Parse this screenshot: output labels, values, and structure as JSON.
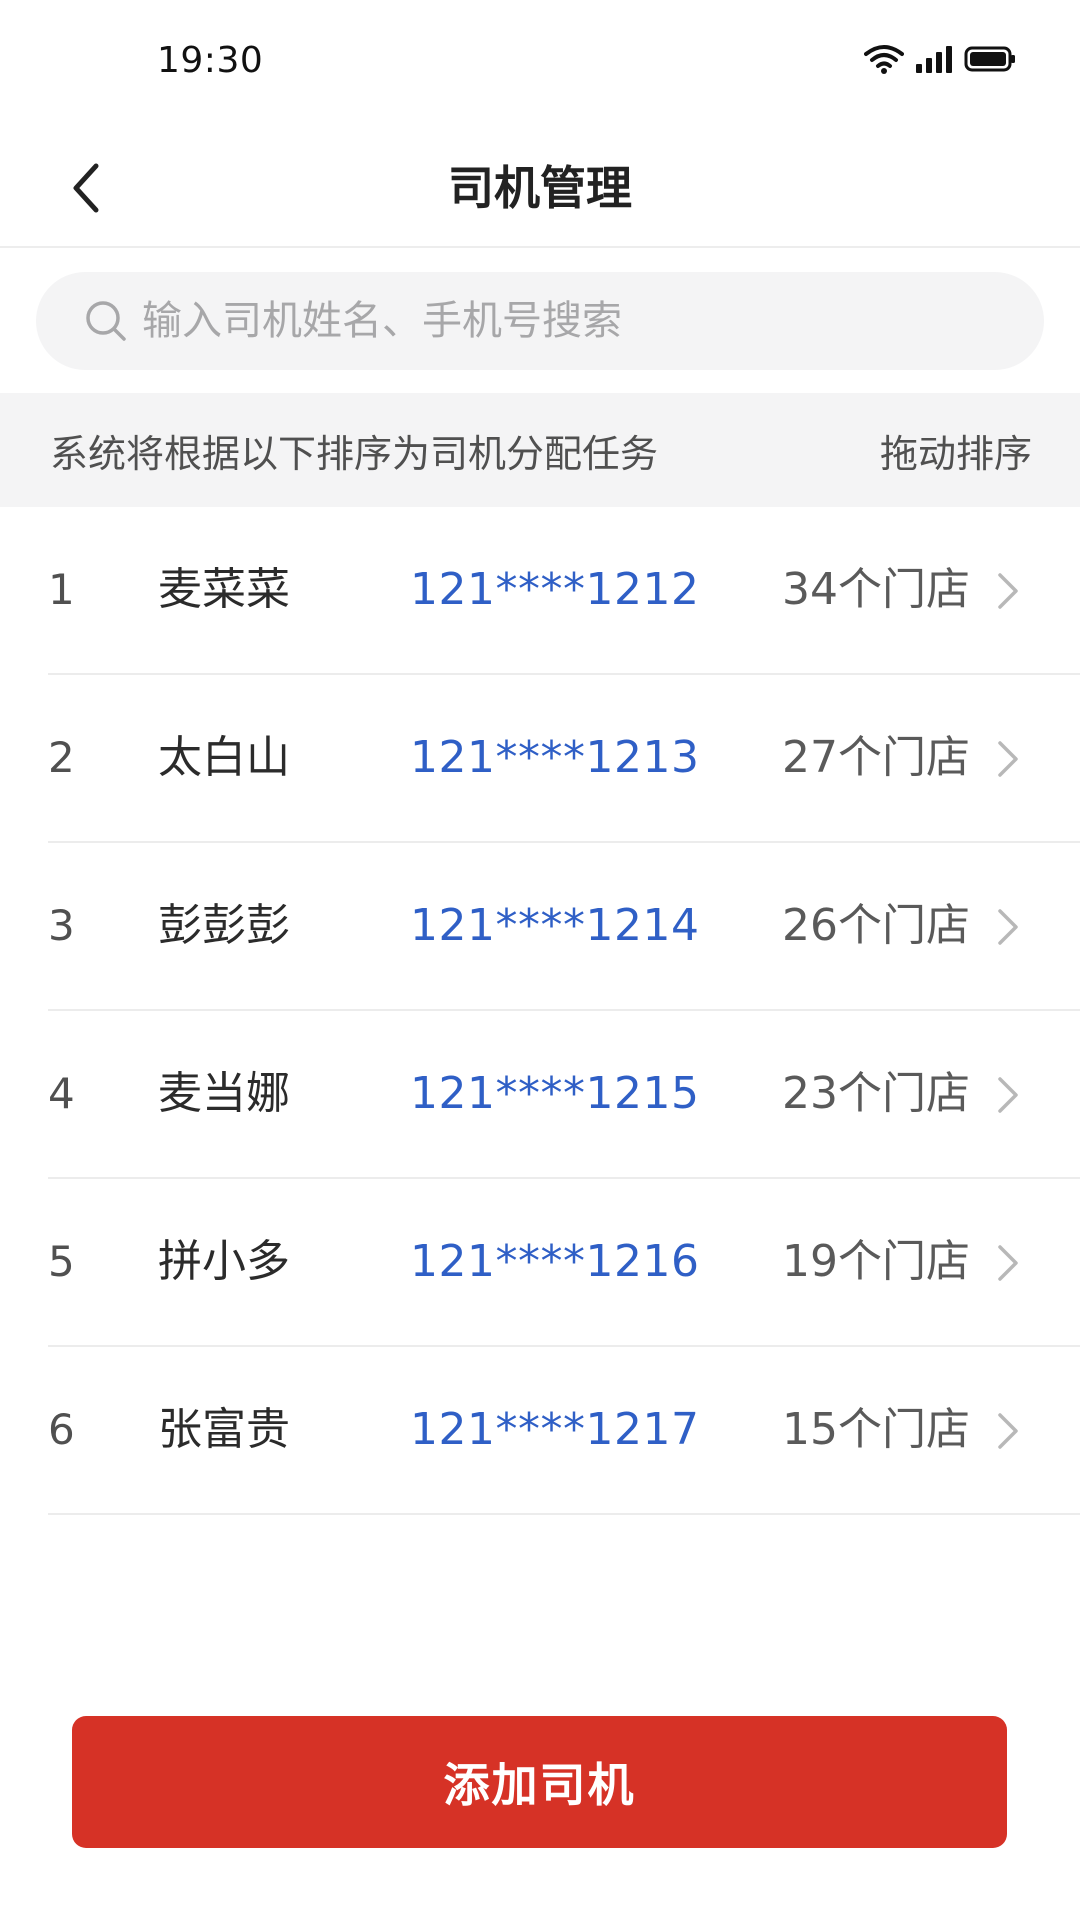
{
  "status_bar": {
    "time": "19:30"
  },
  "nav": {
    "title": "司机管理"
  },
  "search": {
    "placeholder": "输入司机姓名、手机号搜索"
  },
  "hint": {
    "text": "系统将根据以下排序为司机分配任务",
    "drag_sort_label": "拖动排序"
  },
  "drivers": [
    {
      "index": "1",
      "name": "麦菜菜",
      "phone": "121****1212",
      "stores": "34个门店"
    },
    {
      "index": "2",
      "name": "太白山",
      "phone": "121****1213",
      "stores": "27个门店"
    },
    {
      "index": "3",
      "name": "彭彭彭",
      "phone": "121****1214",
      "stores": "26个门店"
    },
    {
      "index": "4",
      "name": "麦当娜",
      "phone": "121****1215",
      "stores": "23个门店"
    },
    {
      "index": "5",
      "name": "拼小多",
      "phone": "121****1216",
      "stores": "19个门店"
    },
    {
      "index": "6",
      "name": "张富贵",
      "phone": "121****1217",
      "stores": "15个门店"
    }
  ],
  "actions": {
    "add_driver_label": "添加司机"
  },
  "colors": {
    "accent_red": "#d63226",
    "phone_blue": "#2f5fc6"
  }
}
